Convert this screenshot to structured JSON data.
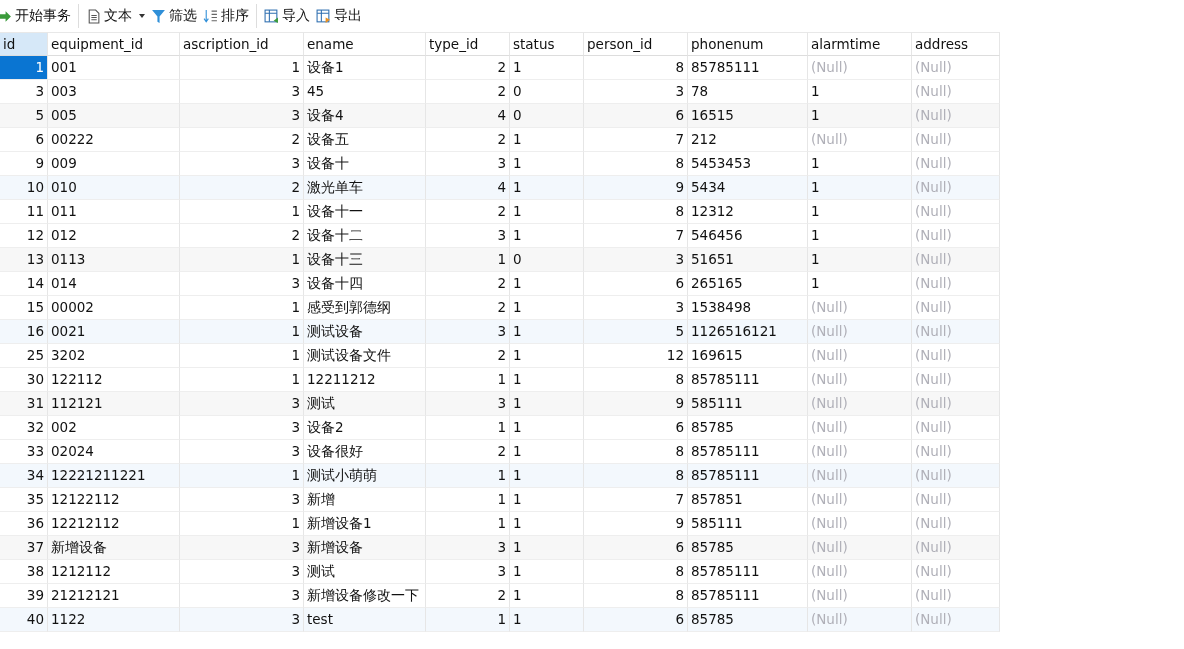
{
  "toolbar": [
    {
      "kind": "transaction",
      "label": "开始事务",
      "separator_after": true
    },
    {
      "kind": "text",
      "label": "文本",
      "dropdown": true
    },
    {
      "kind": "filter",
      "label": "筛选"
    },
    {
      "kind": "sort",
      "label": "排序",
      "separator_after": true
    },
    {
      "kind": "import",
      "label": "导入"
    },
    {
      "kind": "export",
      "label": "导出"
    }
  ],
  "table": {
    "columns": [
      {
        "label": "id",
        "kind": "number"
      },
      {
        "label": "equipment_id",
        "kind": "text"
      },
      {
        "label": "ascription_id",
        "kind": "number"
      },
      {
        "label": "ename",
        "kind": "text"
      },
      {
        "label": "type_id",
        "kind": "number"
      },
      {
        "label": "status",
        "kind": "text"
      },
      {
        "label": "person_id",
        "kind": "number"
      },
      {
        "label": "phonenum",
        "kind": "text"
      },
      {
        "label": "alarmtime",
        "kind": "text"
      },
      {
        "label": "address",
        "kind": "text"
      }
    ],
    "rows": [
      {
        "selected": true,
        "cells": [
          "1",
          "001",
          "1",
          "设备1",
          "2",
          "1",
          "8",
          "85785111",
          "(Null)",
          "(Null)"
        ],
        "null_alarmtime": true,
        "null_address": true
      },
      {
        "selected": false,
        "cells": [
          "3",
          "003",
          "3",
          "45",
          "2",
          "0",
          "3",
          "78",
          "1",
          "(Null)"
        ],
        "null_alarmtime": false,
        "null_address": true
      },
      {
        "selected": false,
        "cells": [
          "5",
          "005",
          "3",
          "设备4",
          "4",
          "0",
          "6",
          "16515",
          "1",
          "(Null)"
        ],
        "null_alarmtime": false,
        "null_address": true
      },
      {
        "selected": false,
        "cells": [
          "6",
          "00222",
          "2",
          "设备五",
          "2",
          "1",
          "7",
          "212",
          "(Null)",
          "(Null)"
        ],
        "null_alarmtime": true,
        "null_address": true
      },
      {
        "selected": false,
        "cells": [
          "9",
          "009",
          "3",
          "设备十",
          "3",
          "1",
          "8",
          "5453453",
          "1",
          "(Null)"
        ],
        "null_alarmtime": false,
        "null_address": true
      },
      {
        "selected": false,
        "cells": [
          "10",
          "010",
          "2",
          "激光单车",
          "4",
          "1",
          "9",
          "5434",
          "1",
          "(Null)"
        ],
        "null_alarmtime": false,
        "null_address": true
      },
      {
        "selected": false,
        "cells": [
          "11",
          "011",
          "1",
          "设备十一",
          "2",
          "1",
          "8",
          "12312",
          "1",
          "(Null)"
        ],
        "null_alarmtime": false,
        "null_address": true
      },
      {
        "selected": false,
        "cells": [
          "12",
          "012",
          "2",
          "设备十二",
          "3",
          "1",
          "7",
          "546456",
          "1",
          "(Null)"
        ],
        "null_alarmtime": false,
        "null_address": true
      },
      {
        "selected": false,
        "cells": [
          "13",
          "0113",
          "1",
          "设备十三",
          "1",
          "0",
          "3",
          "51651",
          "1",
          "(Null)"
        ],
        "null_alarmtime": false,
        "null_address": true
      },
      {
        "selected": false,
        "cells": [
          "14",
          "014",
          "3",
          "设备十四",
          "2",
          "1",
          "6",
          "265165",
          "1",
          "(Null)"
        ],
        "null_alarmtime": false,
        "null_address": true
      },
      {
        "selected": false,
        "cells": [
          "15",
          "00002",
          "1",
          "感受到郭德纲",
          "2",
          "1",
          "3",
          "1538498",
          "(Null)",
          "(Null)"
        ],
        "null_alarmtime": true,
        "null_address": true
      },
      {
        "selected": false,
        "cells": [
          "16",
          "0021",
          "1",
          "测试设备",
          "3",
          "1",
          "5",
          "1126516121",
          "(Null)",
          "(Null)"
        ],
        "null_alarmtime": true,
        "null_address": true
      },
      {
        "selected": false,
        "cells": [
          "25",
          "3202",
          "1",
          "测试设备文件",
          "2",
          "1",
          "12",
          "169615",
          "(Null)",
          "(Null)"
        ],
        "null_alarmtime": true,
        "null_address": true
      },
      {
        "selected": false,
        "cells": [
          "30",
          "122112",
          "1",
          "12211212",
          "1",
          "1",
          "8",
          "85785111",
          "(Null)",
          "(Null)"
        ],
        "null_alarmtime": true,
        "null_address": true
      },
      {
        "selected": false,
        "cells": [
          "31",
          "112121",
          "3",
          "测试",
          "3",
          "1",
          "9",
          "585111",
          "(Null)",
          "(Null)"
        ],
        "null_alarmtime": true,
        "null_address": true
      },
      {
        "selected": false,
        "cells": [
          "32",
          "002",
          "3",
          "设备2",
          "1",
          "1",
          "6",
          "85785",
          "(Null)",
          "(Null)"
        ],
        "null_alarmtime": true,
        "null_address": true
      },
      {
        "selected": false,
        "cells": [
          "33",
          "02024",
          "3",
          "设备很好",
          "2",
          "1",
          "8",
          "85785111",
          "(Null)",
          "(Null)"
        ],
        "null_alarmtime": true,
        "null_address": true
      },
      {
        "selected": false,
        "cells": [
          "34",
          "12221211221",
          "1",
          "测试小萌萌",
          "1",
          "1",
          "8",
          "85785111",
          "(Null)",
          "(Null)"
        ],
        "null_alarmtime": true,
        "null_address": true
      },
      {
        "selected": false,
        "cells": [
          "35",
          "12122112",
          "3",
          "新增",
          "1",
          "1",
          "7",
          "857851",
          "(Null)",
          "(Null)"
        ],
        "null_alarmtime": true,
        "null_address": true
      },
      {
        "selected": false,
        "cells": [
          "36",
          "12212112",
          "1",
          "新增设备1",
          "1",
          "1",
          "9",
          "585111",
          "(Null)",
          "(Null)"
        ],
        "null_alarmtime": true,
        "null_address": true
      },
      {
        "selected": false,
        "cells": [
          "37",
          "新增设备",
          "3",
          "新增设备",
          "3",
          "1",
          "6",
          "85785",
          "(Null)",
          "(Null)"
        ],
        "null_alarmtime": true,
        "null_address": true
      },
      {
        "selected": false,
        "cells": [
          "38",
          "1212112",
          "3",
          "测试",
          "3",
          "1",
          "8",
          "85785111",
          "(Null)",
          "(Null)"
        ],
        "null_alarmtime": true,
        "null_address": true
      },
      {
        "selected": false,
        "cells": [
          "39",
          "21212121",
          "3",
          "新增设备修改一下",
          "2",
          "1",
          "8",
          "85785111",
          "(Null)",
          "(Null)"
        ],
        "null_alarmtime": true,
        "null_address": true
      },
      {
        "selected": false,
        "cells": [
          "40",
          "1122",
          "3",
          "test",
          "1",
          "1",
          "6",
          "85785",
          "(Null)",
          "(Null)"
        ],
        "null_alarmtime": true,
        "null_address": true
      }
    ]
  }
}
